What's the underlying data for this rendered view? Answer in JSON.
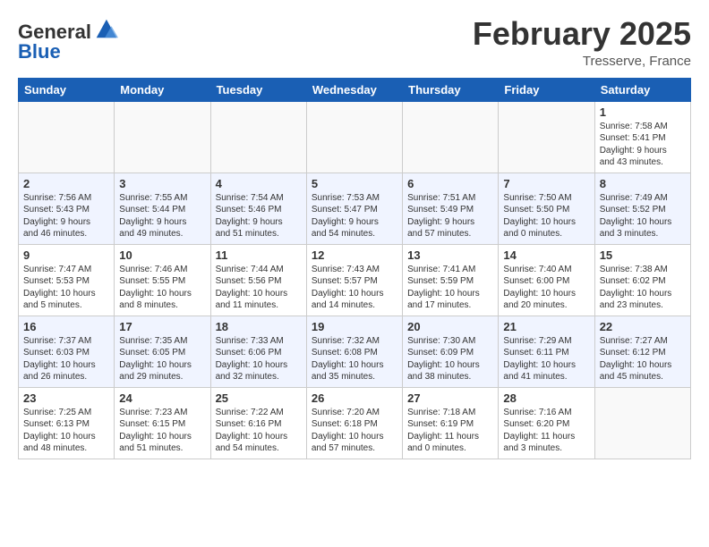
{
  "header": {
    "logo_general": "General",
    "logo_blue": "Blue",
    "month_title": "February 2025",
    "location": "Tresserve, France"
  },
  "days_of_week": [
    "Sunday",
    "Monday",
    "Tuesday",
    "Wednesday",
    "Thursday",
    "Friday",
    "Saturday"
  ],
  "weeks": [
    {
      "row_class": "normal-row",
      "days": [
        {
          "num": "",
          "info": ""
        },
        {
          "num": "",
          "info": ""
        },
        {
          "num": "",
          "info": ""
        },
        {
          "num": "",
          "info": ""
        },
        {
          "num": "",
          "info": ""
        },
        {
          "num": "",
          "info": ""
        },
        {
          "num": "1",
          "info": "Sunrise: 7:58 AM\nSunset: 5:41 PM\nDaylight: 9 hours\nand 43 minutes."
        }
      ]
    },
    {
      "row_class": "alt-row",
      "days": [
        {
          "num": "2",
          "info": "Sunrise: 7:56 AM\nSunset: 5:43 PM\nDaylight: 9 hours\nand 46 minutes."
        },
        {
          "num": "3",
          "info": "Sunrise: 7:55 AM\nSunset: 5:44 PM\nDaylight: 9 hours\nand 49 minutes."
        },
        {
          "num": "4",
          "info": "Sunrise: 7:54 AM\nSunset: 5:46 PM\nDaylight: 9 hours\nand 51 minutes."
        },
        {
          "num": "5",
          "info": "Sunrise: 7:53 AM\nSunset: 5:47 PM\nDaylight: 9 hours\nand 54 minutes."
        },
        {
          "num": "6",
          "info": "Sunrise: 7:51 AM\nSunset: 5:49 PM\nDaylight: 9 hours\nand 57 minutes."
        },
        {
          "num": "7",
          "info": "Sunrise: 7:50 AM\nSunset: 5:50 PM\nDaylight: 10 hours\nand 0 minutes."
        },
        {
          "num": "8",
          "info": "Sunrise: 7:49 AM\nSunset: 5:52 PM\nDaylight: 10 hours\nand 3 minutes."
        }
      ]
    },
    {
      "row_class": "normal-row",
      "days": [
        {
          "num": "9",
          "info": "Sunrise: 7:47 AM\nSunset: 5:53 PM\nDaylight: 10 hours\nand 5 minutes."
        },
        {
          "num": "10",
          "info": "Sunrise: 7:46 AM\nSunset: 5:55 PM\nDaylight: 10 hours\nand 8 minutes."
        },
        {
          "num": "11",
          "info": "Sunrise: 7:44 AM\nSunset: 5:56 PM\nDaylight: 10 hours\nand 11 minutes."
        },
        {
          "num": "12",
          "info": "Sunrise: 7:43 AM\nSunset: 5:57 PM\nDaylight: 10 hours\nand 14 minutes."
        },
        {
          "num": "13",
          "info": "Sunrise: 7:41 AM\nSunset: 5:59 PM\nDaylight: 10 hours\nand 17 minutes."
        },
        {
          "num": "14",
          "info": "Sunrise: 7:40 AM\nSunset: 6:00 PM\nDaylight: 10 hours\nand 20 minutes."
        },
        {
          "num": "15",
          "info": "Sunrise: 7:38 AM\nSunset: 6:02 PM\nDaylight: 10 hours\nand 23 minutes."
        }
      ]
    },
    {
      "row_class": "alt-row",
      "days": [
        {
          "num": "16",
          "info": "Sunrise: 7:37 AM\nSunset: 6:03 PM\nDaylight: 10 hours\nand 26 minutes."
        },
        {
          "num": "17",
          "info": "Sunrise: 7:35 AM\nSunset: 6:05 PM\nDaylight: 10 hours\nand 29 minutes."
        },
        {
          "num": "18",
          "info": "Sunrise: 7:33 AM\nSunset: 6:06 PM\nDaylight: 10 hours\nand 32 minutes."
        },
        {
          "num": "19",
          "info": "Sunrise: 7:32 AM\nSunset: 6:08 PM\nDaylight: 10 hours\nand 35 minutes."
        },
        {
          "num": "20",
          "info": "Sunrise: 7:30 AM\nSunset: 6:09 PM\nDaylight: 10 hours\nand 38 minutes."
        },
        {
          "num": "21",
          "info": "Sunrise: 7:29 AM\nSunset: 6:11 PM\nDaylight: 10 hours\nand 41 minutes."
        },
        {
          "num": "22",
          "info": "Sunrise: 7:27 AM\nSunset: 6:12 PM\nDaylight: 10 hours\nand 45 minutes."
        }
      ]
    },
    {
      "row_class": "normal-row",
      "days": [
        {
          "num": "23",
          "info": "Sunrise: 7:25 AM\nSunset: 6:13 PM\nDaylight: 10 hours\nand 48 minutes."
        },
        {
          "num": "24",
          "info": "Sunrise: 7:23 AM\nSunset: 6:15 PM\nDaylight: 10 hours\nand 51 minutes."
        },
        {
          "num": "25",
          "info": "Sunrise: 7:22 AM\nSunset: 6:16 PM\nDaylight: 10 hours\nand 54 minutes."
        },
        {
          "num": "26",
          "info": "Sunrise: 7:20 AM\nSunset: 6:18 PM\nDaylight: 10 hours\nand 57 minutes."
        },
        {
          "num": "27",
          "info": "Sunrise: 7:18 AM\nSunset: 6:19 PM\nDaylight: 11 hours\nand 0 minutes."
        },
        {
          "num": "28",
          "info": "Sunrise: 7:16 AM\nSunset: 6:20 PM\nDaylight: 11 hours\nand 3 minutes."
        },
        {
          "num": "",
          "info": ""
        }
      ]
    }
  ]
}
